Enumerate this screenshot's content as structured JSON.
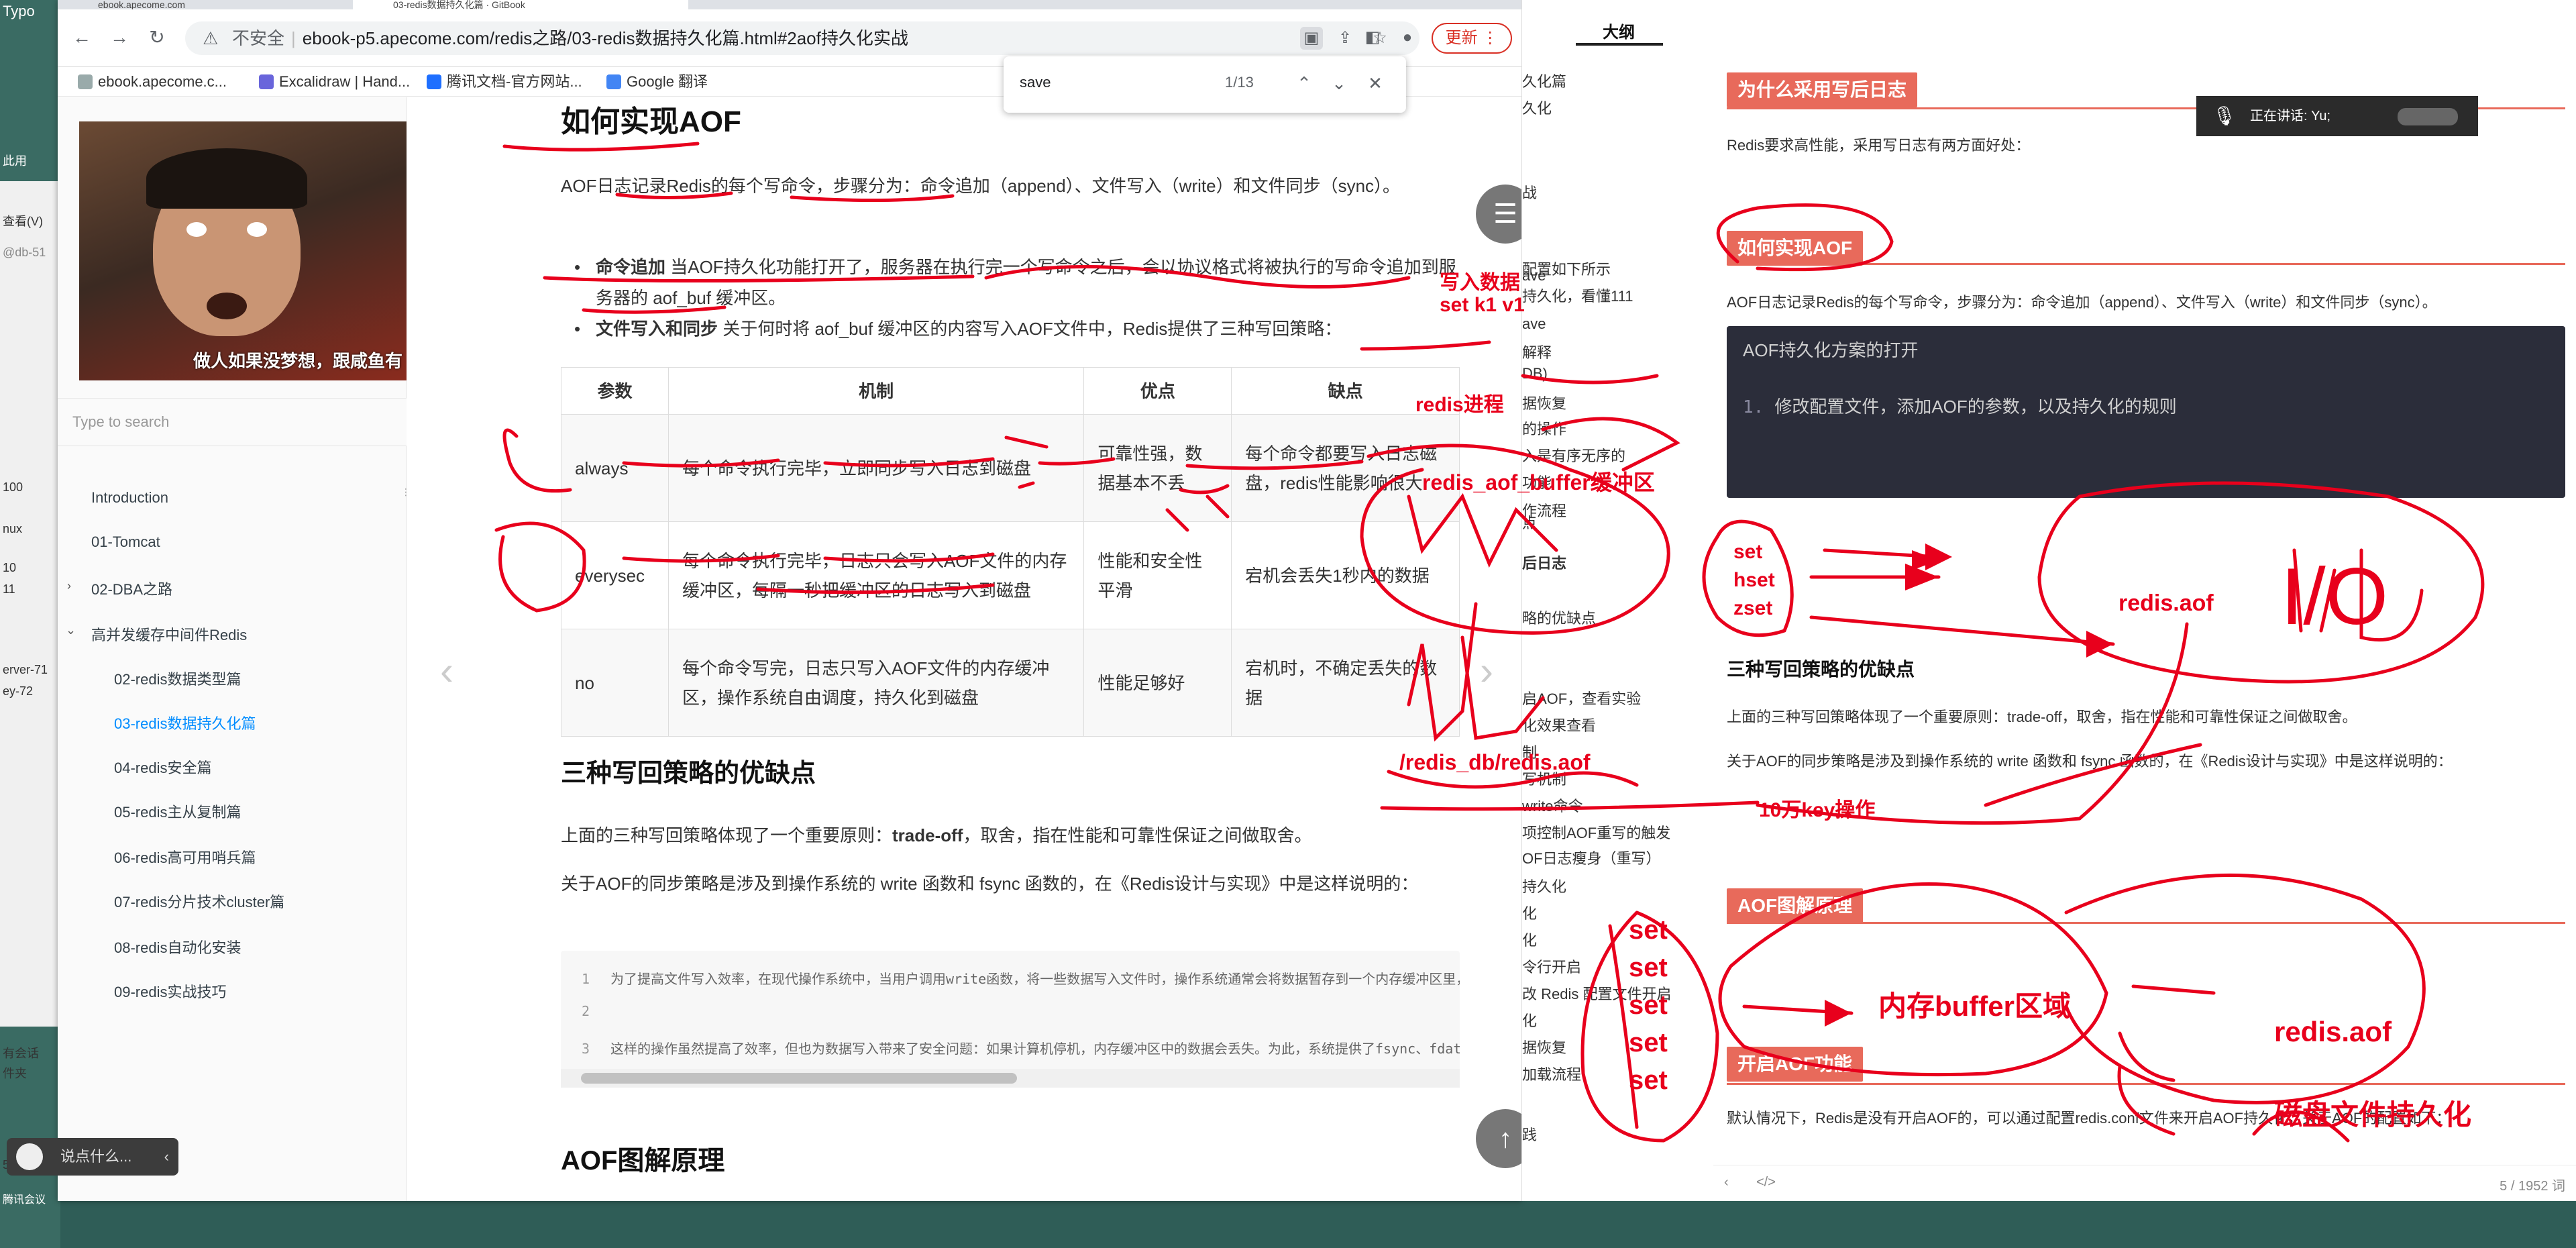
{
  "desktop": {
    "labels": [
      "Typo",
      "此用",
      "查看(V)",
      "@db-51",
      "100",
      "nux",
      "10",
      "11",
      "erver-71",
      "ey-72",
      "有会话",
      "件夹",
      "51",
      "腾讯会议"
    ]
  },
  "browser": {
    "tabs": [
      "ebook.apecome.com",
      "03-redis数据持久化篇 · GitBook"
    ],
    "omnibox": {
      "insecure": "不安全",
      "url": "ebook-p5.apecome.com/redis之路/03-redis数据持久化篇.html#2aof持久化实战"
    },
    "update_label": "更新",
    "bookmarks": [
      "ebook.apecome.c...",
      "Excalidraw | Hand...",
      "腾讯文档-官方网站...",
      "Google 翻译"
    ],
    "find": {
      "query": "save",
      "count": "1/13"
    }
  },
  "gitbook": {
    "meme_caption": "做人如果没梦想，跟咸鱼有",
    "search_placeholder": "Type to search",
    "nav": [
      {
        "label": "Introduction"
      },
      {
        "label": "01-Tomcat"
      },
      {
        "label": "02-DBA之路"
      },
      {
        "label": "高并发缓存中间件Redis"
      },
      {
        "label": "02-redis数据类型篇"
      },
      {
        "label": "03-redis数据持久化篇"
      },
      {
        "label": "04-redis安全篇"
      },
      {
        "label": "05-redis主从复制篇"
      },
      {
        "label": "06-redis高可用哨兵篇"
      },
      {
        "label": "07-redis分片技术cluster篇"
      },
      {
        "label": "08-redis自动化安装"
      },
      {
        "label": "09-redis实战技巧"
      }
    ],
    "content": {
      "h_how": "如何实现AOF",
      "p_intro": "AOF日志记录Redis的每个写命令，步骤分为：命令追加（append）、文件写入（write）和文件同步（sync）。",
      "li1_bold": "命令追加",
      "li1_text": " 当AOF持久化功能打开了，服务器在执行完一个写命令之后，会以协议格式将被执行的写命令追加到服务器的 aof_buf 缓冲区。",
      "li2_bold": "文件写入和同步",
      "li2_text": " 关于何时将 aof_buf 缓冲区的内容写入AOF文件中，Redis提供了三种写回策略：",
      "table": {
        "headers": [
          "参数",
          "机制",
          "优点",
          "缺点"
        ],
        "rows": [
          [
            "always",
            "每个命令执行完毕，立即同步写入日志到磁盘",
            "可靠性强，数据基本不丢",
            "每个命令都要写入日志磁盘，redis性能影响很大"
          ],
          [
            "everysec",
            "每个命令执行完毕，日志只会写入AOF文件的内存缓冲区，每隔一秒把缓冲区的日志写入到磁盘",
            "性能和安全性平滑",
            "宕机会丢失1秒内的数据"
          ],
          [
            "no",
            "每个命令写完，日志只写入AOF文件的内存缓冲区，操作系统自由调度，持久化到磁盘",
            "性能足够好",
            "宕机时，不确定丢失的数据"
          ]
        ]
      },
      "h_pros": "三种写回策略的优缺点",
      "p_tradeoff_a": "上面的三种写回策略体现了一个重要原则：",
      "p_tradeoff_b": "trade-off",
      "p_tradeoff_c": "，取舍，指在性能和可靠性保证之间做取舍。",
      "p_sync": "关于AOF的同步策略是涉及到操作系统的 write 函数和 fsync 函数的，在《Redis设计与实现》中是这样说明的：",
      "code": [
        {
          "n": "1",
          "t": "为了提高文件写入效率，在现代操作系统中，当用户调用write函数，将一些数据写入文件时，操作系统通常会将数据暂存到一个内存缓冲区里，当缓冲区的空间被填满或超过了指定时限后，才真正将缓冲区的数据写入到磁盘里。"
        },
        {
          "n": "2",
          "t": ""
        },
        {
          "n": "3",
          "t": "这样的操作虽然提高了效率，但也为数据写入带来了安全问题：如果计算机停机，内存缓冲区中的数据会丢失。为此，系统提供了fsync、fdatasync同步函数，可以强制操作系统立刻将缓冲区中的数据写入到硬盘里，从而确保写入数据的安全性。"
        }
      ],
      "h_diagram": "AOF图解原理"
    }
  },
  "outline": {
    "title": "大纲",
    "items": [
      "久化篇",
      "久化",
      "战",
      "ave",
      "配置如下所示",
      "持久化，看懂111",
      "ave",
      "解释",
      "DB)",
      "据恢复",
      "的操作",
      "入是有序无序的",
      "功能",
      "作流程",
      "点",
      "后日志",
      "略的优缺点",
      "启AOF，查看实验",
      "化效果查看",
      "制",
      "写机制",
      "write命令",
      "项控制AOF重写的触发",
      "OF日志瘦身（重写）",
      "持久化",
      "化",
      "化",
      "令行开启",
      "改 Redis 配置文件开启",
      "化",
      "据恢复",
      "加载流程",
      "践"
    ]
  },
  "doc": {
    "h_why": "为什么采用写后日志",
    "p_why": "Redis要求高性能，采用写日志有两方面好处：",
    "h_how": "如何实现AOF",
    "p_how": "AOF日志记录Redis的每个写命令，步骤分为：命令追加（append）、文件写入（write）和文件同步（sync）。",
    "code_title": "AOF持久化方案的打开",
    "code_line_no": "1.",
    "code_line": "修改配置文件，添加AOF的参数，以及持久化的规则",
    "h3_pros": "三种写回策略的优缺点",
    "p_tradeoff": "上面的三种写回策略体现了一个重要原则：trade-off，取舍，指在性能和可靠性保证之间做取舍。",
    "p_sync": "关于AOF的同步策略是涉及到操作系统的 write 函数和 fsync 函数的，在《Redis设计与实现》中是这样说明的：",
    "h_diagram": "AOF图解原理",
    "h_enable": "开启AOF功能",
    "p_enable": "默认情况下，Redis是没有开启AOF的，可以通过配置redis.conf文件来开启AOF持久化，关于AOF的配置如下：",
    "footer_words": "5 / 1952 词",
    "speaking": "正在讲话: Yu;"
  },
  "meeting": {
    "placeholder": "说点什么..."
  },
  "annotations": {
    "write_data": "写入数据",
    "set_k1": "set k1 v1",
    "redis_proc": "redis进程",
    "aof_buffer": "redis_aof_buffer缓冲区",
    "aof_path": "/redis_db/redis.aof",
    "ops_10w": "10万key操作",
    "cmds1": [
      "set",
      "hset",
      "zset"
    ],
    "redis_aof_1": "redis.aof",
    "io": "I/O",
    "cmds2": [
      "set",
      "set",
      "set",
      "set",
      "set"
    ],
    "mem_buffer": "内存buffer区域",
    "redis_aof_2": "redis.aof",
    "disk_persist": "磁盘文件持久化"
  },
  "colors": {
    "ink": "#e8001c",
    "heading_bg": "#e86a5b",
    "link": "#008cff"
  }
}
